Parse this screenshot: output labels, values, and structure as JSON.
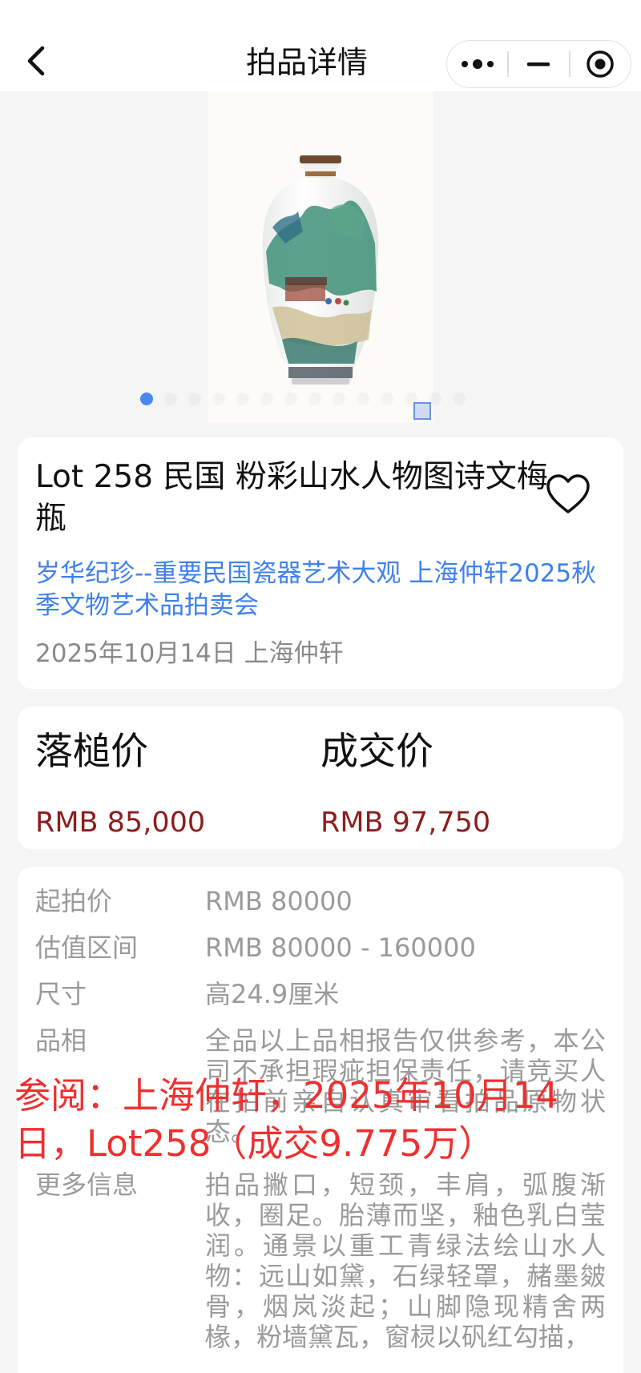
{
  "header": {
    "title": "拍品详情",
    "back_icon": "chevron-left-icon",
    "capsule": {
      "more_icon": "more-dots-icon",
      "minimize_icon": "minimize-icon",
      "close_icon": "target-close-icon"
    }
  },
  "carousel": {
    "image_desc": "vase",
    "total_images": 14,
    "active_index": 0,
    "accent_color": "#4a87f0"
  },
  "lot": {
    "title": "Lot 258 民国 粉彩山水人物图诗文梅瓶",
    "auction_link": "岁华纪珍--重要民国瓷器艺术大观 上海仲轩2025秋季文物艺术品拍卖会",
    "sale_info": "2025年10月14日 上海仲轩",
    "favorite_icon": "heart-outline-icon"
  },
  "prices": {
    "hammer_label": "落槌价",
    "hammer_value": "RMB 85,000",
    "deal_label": "成交价",
    "deal_value": "RMB 97,750",
    "value_color": "#8c1d1d"
  },
  "details": [
    {
      "label": "起拍价",
      "value": "RMB 80000"
    },
    {
      "label": "估值区间",
      "value": "RMB 80000 - 160000"
    },
    {
      "label": "尺寸",
      "value": "高24.9厘米"
    },
    {
      "label": "品相",
      "value": "全品以上品相报告仅供参考，本公司不承担瑕疵担保责任，请竞买人在拍前亲自认真审看拍品原物状态。"
    },
    {
      "label": "更多信息",
      "value": "拍品撇口，短颈，丰肩，弧腹渐收，圈足。胎薄而坚，釉色乳白莹润。通景以重工青绿法绘山水人物：远山如黛，石绿轻罩，赭墨皴骨，烟岚淡起；山脚隐现精舍两椽，粉墙黛瓦，窗棂以矾红勾描，"
    }
  ],
  "watermark": "参阅：上海仲轩，2025年10月14日，Lot258（成交9.775万）"
}
